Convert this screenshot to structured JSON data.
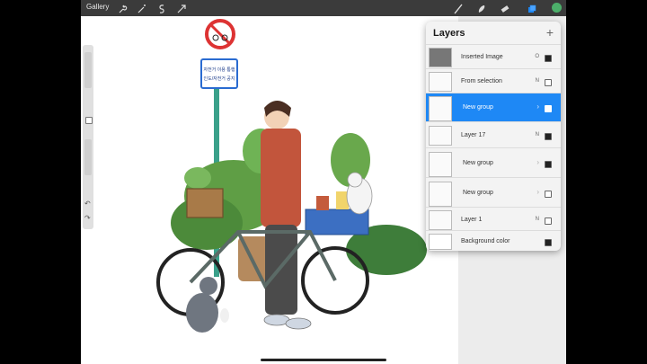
{
  "topbar": {
    "gallery_label": "Gallery",
    "left_tools": [
      "wrench-icon",
      "magic-wand-icon",
      "selection-icon",
      "transform-arrow-icon"
    ],
    "right_tools": [
      "brush-icon",
      "smudge-icon",
      "eraser-icon",
      "layers-icon"
    ],
    "active_color": "#4caf6a"
  },
  "sign": {
    "text_lines": [
      "자전거 이용 통행",
      "인도/자전거 공지"
    ]
  },
  "layers_panel": {
    "title": "Layers",
    "add_icon": "plus-icon",
    "accent": "#1e88f5",
    "rows": [
      {
        "name": "Inserted Image",
        "mode": "O",
        "checked": true,
        "selected": false,
        "group": false
      },
      {
        "name": "From selection",
        "mode": "N",
        "checked": false,
        "selected": false,
        "group": false
      },
      {
        "name": "New group",
        "mode": "",
        "checked": true,
        "selected": true,
        "group": true
      },
      {
        "name": "Layer 17",
        "mode": "N",
        "checked": true,
        "selected": false,
        "group": false
      },
      {
        "name": "New group",
        "mode": "",
        "checked": true,
        "selected": false,
        "group": true
      },
      {
        "name": "New group",
        "mode": "",
        "checked": false,
        "selected": false,
        "group": true
      },
      {
        "name": "Layer 1",
        "mode": "N",
        "checked": false,
        "selected": false,
        "group": false
      },
      {
        "name": "Background color",
        "mode": "",
        "checked": true,
        "selected": false,
        "group": false
      }
    ]
  }
}
